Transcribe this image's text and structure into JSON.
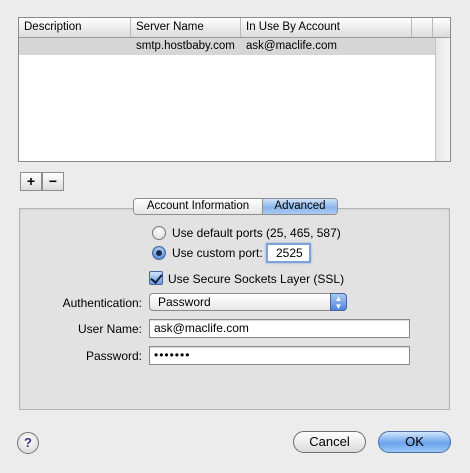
{
  "table": {
    "columns": [
      "Description",
      "Server Name",
      "In Use By Account"
    ],
    "rows": [
      {
        "description": "",
        "server": "smtp.hostbaby.com",
        "account": "ask@maclife.com"
      }
    ]
  },
  "list_controls": {
    "add_label": "+",
    "remove_label": "−"
  },
  "tabs": {
    "account_info": "Account Information",
    "advanced": "Advanced",
    "selected": "Advanced"
  },
  "advanced": {
    "default_ports_label": "Use default ports (25, 465, 587)",
    "custom_port_label": "Use custom port:",
    "custom_port_selected": true,
    "custom_port_value": "2525",
    "ssl_label": "Use Secure Sockets Layer (SSL)",
    "ssl_checked": true,
    "authentication_label": "Authentication:",
    "authentication_value": "Password",
    "username_label": "User Name:",
    "username_value": "ask@maclife.com",
    "password_label": "Password:",
    "password_value": "•••••••"
  },
  "footer": {
    "help_label": "?",
    "cancel_label": "Cancel",
    "ok_label": "OK"
  },
  "colors": {
    "accent": "#6aa3ec",
    "selection_row": "#d6d6d6"
  }
}
